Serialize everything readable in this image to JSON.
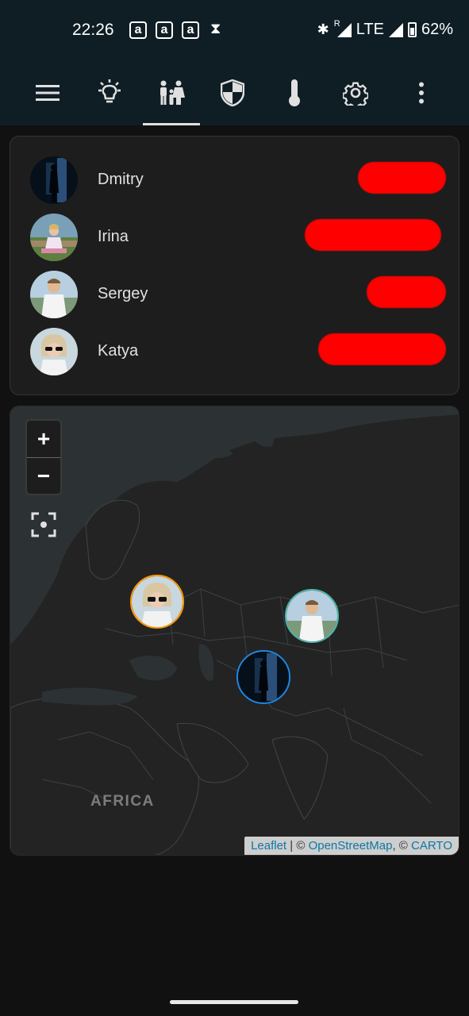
{
  "status_bar": {
    "time": "22:26",
    "notification_icons": [
      "a",
      "a",
      "a"
    ],
    "network": "LTE",
    "roaming": "R",
    "battery": "62%"
  },
  "toolbar": {
    "items": [
      {
        "icon": "menu-icon"
      },
      {
        "icon": "lightbulb-icon"
      },
      {
        "icon": "family-icon",
        "selected": true
      },
      {
        "icon": "shield-icon"
      },
      {
        "icon": "thermometer-icon"
      },
      {
        "icon": "gear-icon"
      },
      {
        "icon": "more-vert-icon"
      }
    ]
  },
  "persons": [
    {
      "name": "Dmitry",
      "avatar": "dark-silhouette"
    },
    {
      "name": "Irina",
      "avatar": "outdoor-photo"
    },
    {
      "name": "Sergey",
      "avatar": "man-white-shirt"
    },
    {
      "name": "Katya",
      "avatar": "woman-sunglasses"
    }
  ],
  "map": {
    "zoom_in": "+",
    "zoom_out": "−",
    "label_africa": "AFRICA",
    "attribution": {
      "leaflet": "Leaflet",
      "sep1": " | © ",
      "osm": "OpenStreetMap",
      "sep2": ", © ",
      "carto": "CARTO"
    },
    "marker_border_colors": {
      "katya": "#ff9800",
      "sergey": "#4db6ac",
      "dmitry": "#1e88e5"
    }
  },
  "colors": {
    "background": "#111111",
    "appbar": "#0f1e24",
    "card": "#1d1d1d",
    "redaction": "#ff0000",
    "link": "#0b78a8"
  }
}
